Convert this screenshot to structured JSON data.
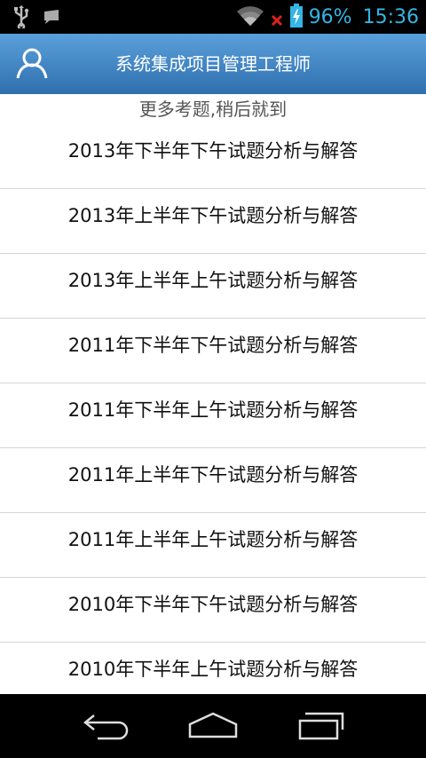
{
  "status_bar": {
    "battery": "96%",
    "time": "15:36",
    "icons": [
      "usb-icon",
      "notification-icon",
      "wifi-icon",
      "no-signal-icon",
      "battery-charging-icon"
    ],
    "accent_color": "#33b5e5"
  },
  "app_bar": {
    "title": "系统集成项目管理工程师",
    "user_icon": "user-icon",
    "colors": [
      "#5aa0db",
      "#2f6fae"
    ]
  },
  "notice": "更多考题,稍后就到",
  "items": [
    "2013年下半年下午试题分析与解答",
    "2013年上半年下午试题分析与解答",
    "2013年上半年上午试题分析与解答",
    "2011年下半年下午试题分析与解答",
    "2011年下半年上午试题分析与解答",
    "2011年上半年下午试题分析与解答",
    "2011年上半年上午试题分析与解答",
    "2010年下半年下午试题分析与解答",
    "2010年下半年上午试题分析与解答"
  ],
  "nav_bar": {
    "buttons": [
      "back-icon",
      "home-icon",
      "recent-apps-icon"
    ]
  }
}
